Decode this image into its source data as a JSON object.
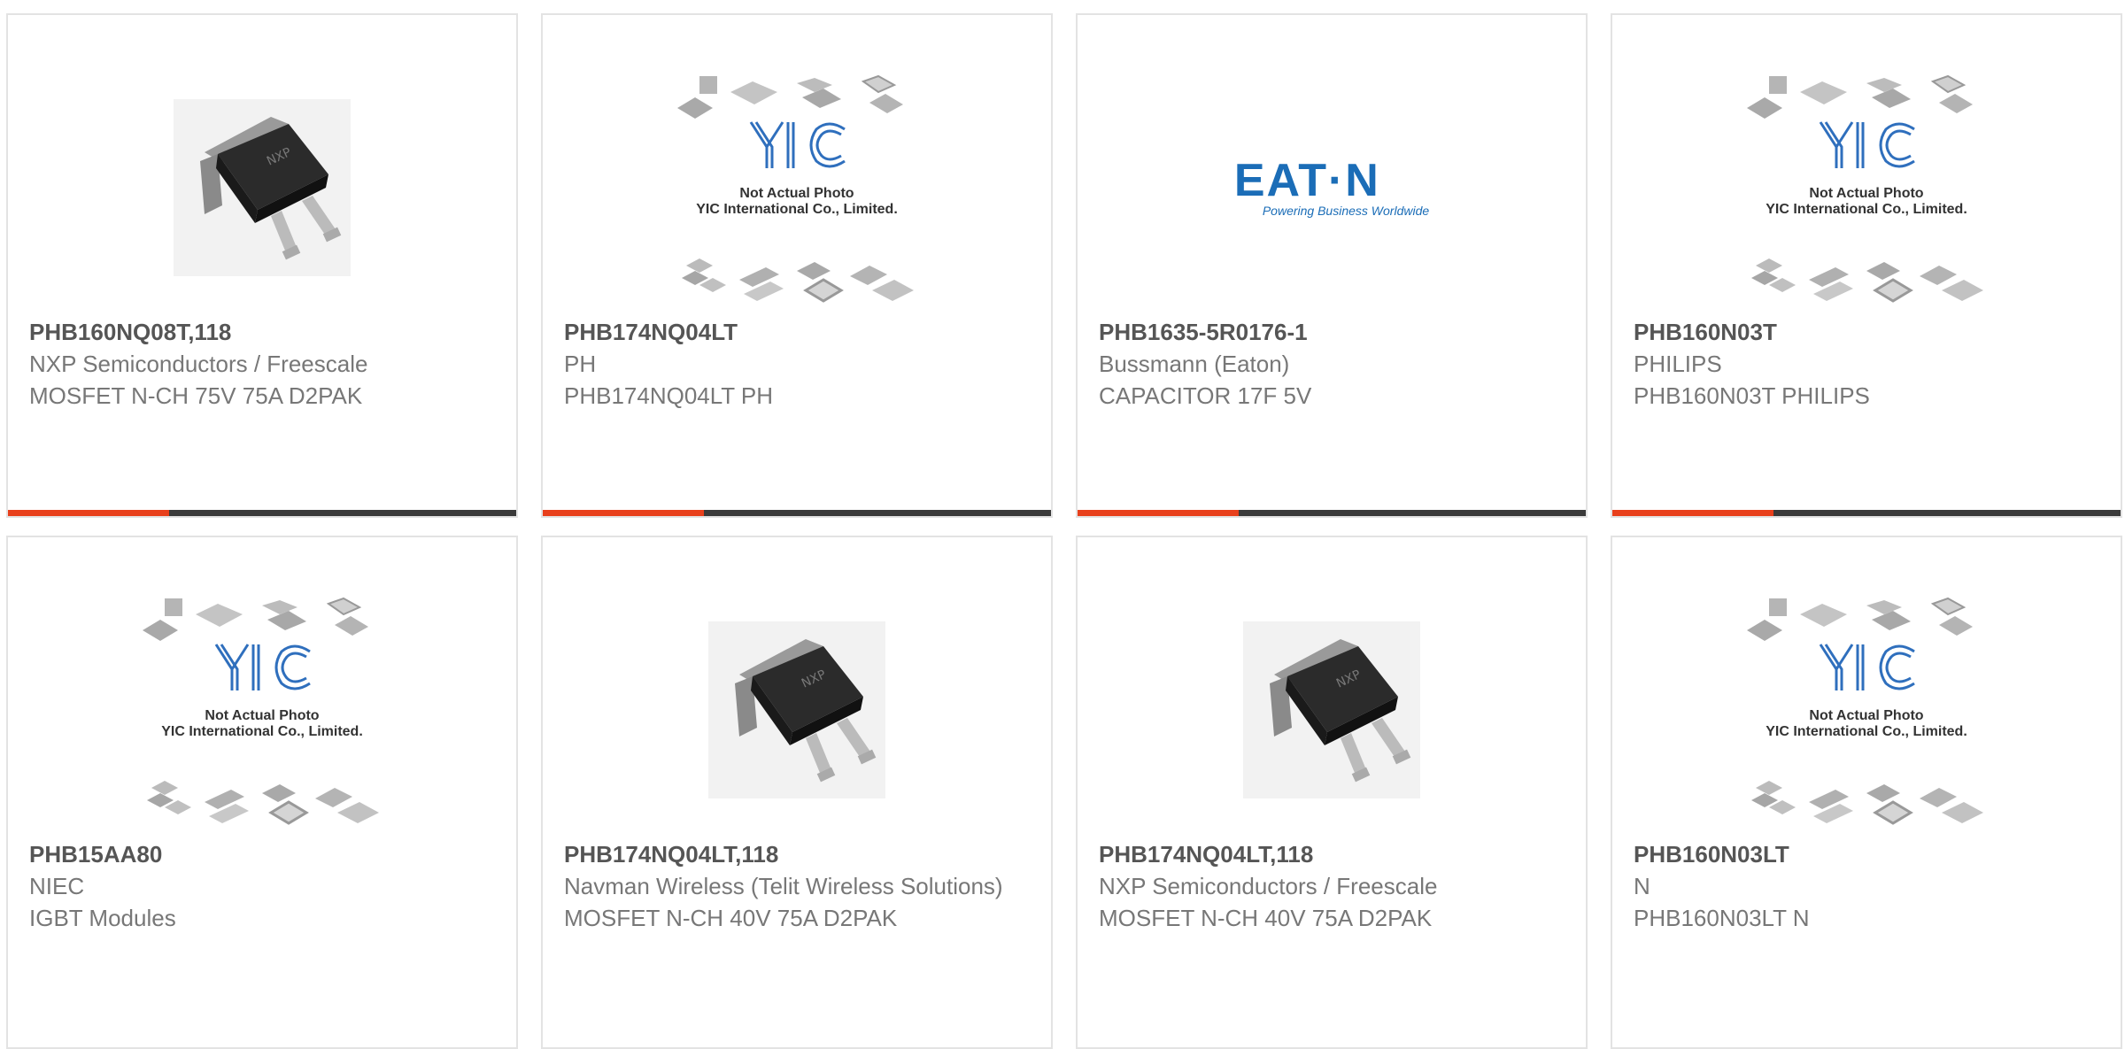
{
  "colors": {
    "accent": "#e8401c",
    "bar": "#3a3a3a",
    "title": "#555555",
    "text": "#777777",
    "border": "#e3e3e3",
    "eaton_blue": "#1b6db7"
  },
  "placeholder": {
    "line1": "Not Actual Photo",
    "line2": "YIC International Co., Limited."
  },
  "eaton": {
    "logo": "EAT·N",
    "tagline": "Powering Business Worldwide"
  },
  "products": [
    {
      "part": "PHB160NQ08T,118",
      "maker": "NXP Semiconductors / Freescale",
      "desc": "MOSFET N-CH 75V 75A D2PAK",
      "image": "mosfet-d2pak-icon"
    },
    {
      "part": "PHB174NQ04LT",
      "maker": "PH",
      "desc": "PHB174NQ04LT PH",
      "image": "yic-placeholder-icon"
    },
    {
      "part": "PHB1635-5R0176-1",
      "maker": "Bussmann (Eaton)",
      "desc": "CAPACITOR 17F 5V",
      "image": "eaton-logo"
    },
    {
      "part": "PHB160N03T",
      "maker": "PHILIPS",
      "desc": "PHB160N03T PHILIPS",
      "image": "yic-placeholder-icon"
    },
    {
      "part": "PHB15AA80",
      "maker": "NIEC",
      "desc": "IGBT Modules",
      "image": "yic-placeholder-icon"
    },
    {
      "part": "PHB174NQ04LT,118",
      "maker": "Navman Wireless (Telit Wireless Solutions)",
      "desc": "MOSFET N-CH 40V 75A D2PAK",
      "image": "mosfet-d2pak-icon"
    },
    {
      "part": "PHB174NQ04LT,118",
      "maker": "NXP Semiconductors / Freescale",
      "desc": "MOSFET N-CH 40V 75A D2PAK",
      "image": "mosfet-d2pak-icon"
    },
    {
      "part": "PHB160N03LT",
      "maker": "N",
      "desc": "PHB160N03LT N",
      "image": "yic-placeholder-icon"
    }
  ]
}
